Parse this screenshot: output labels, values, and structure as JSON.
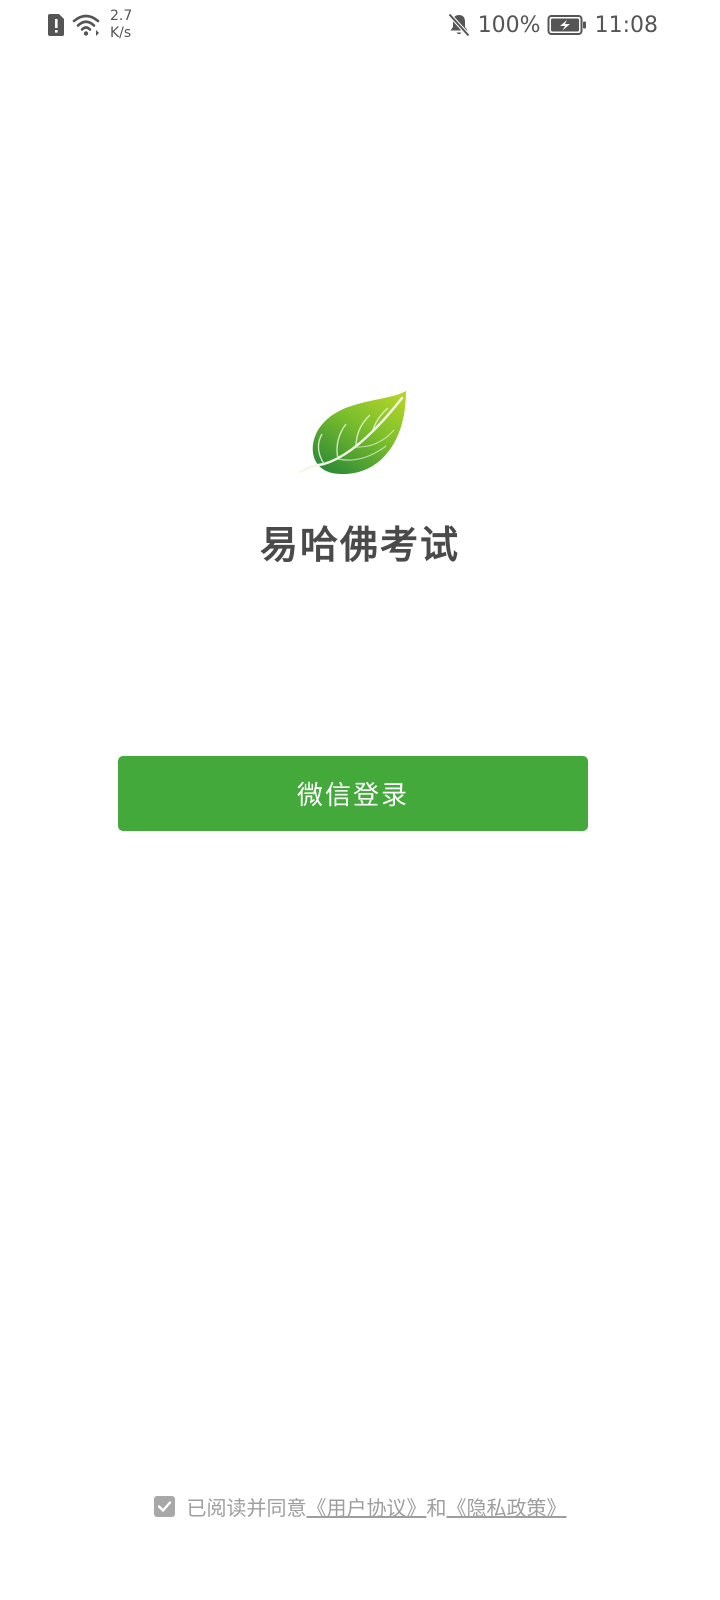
{
  "status_bar": {
    "network_speed_value": "2.7",
    "network_speed_unit": "K/s",
    "battery_percent": "100%",
    "time": "11:08",
    "icons": {
      "left": [
        "sim-alert-icon",
        "wifi-icon"
      ],
      "right": [
        "bell-muted-icon",
        "battery-charging-icon"
      ]
    }
  },
  "app": {
    "title": "易哈佛考试",
    "logo_icon": "leaf-icon"
  },
  "login": {
    "button_label": "微信登录"
  },
  "agreement": {
    "checked": true,
    "prefix": "已阅读并同意",
    "user_agreement": "《用户协议》",
    "conjunction": "和",
    "privacy_policy": "《隐私政策》"
  },
  "colors": {
    "primary_green": "#43a93a",
    "title_text": "#4a4a4a",
    "muted_text": "#9e9e9e",
    "status_text": "#555555"
  }
}
